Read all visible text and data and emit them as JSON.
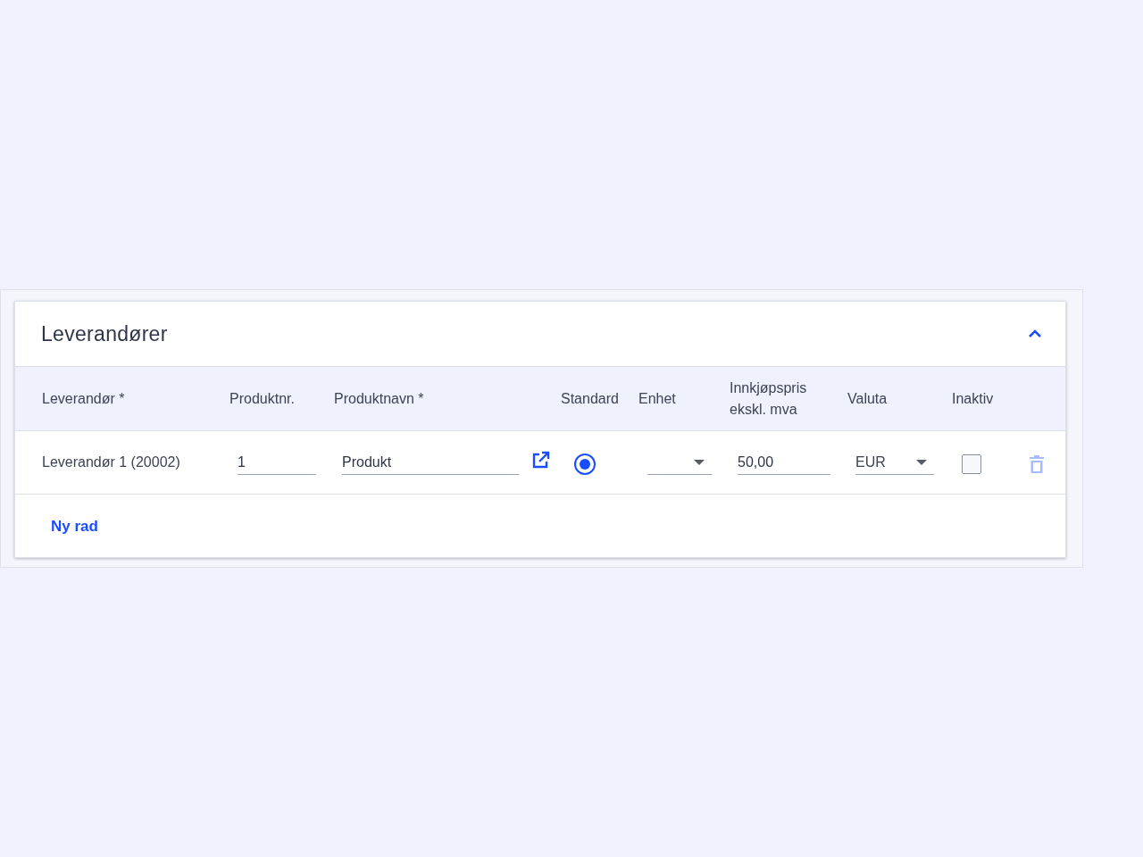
{
  "section": {
    "title": "Leverandører",
    "expanded": true
  },
  "table": {
    "columns": [
      "Leverandør *",
      "Produktnr.",
      "Produktnavn *",
      "Standard",
      "Enhet",
      "Innkjøpspris ekskl. mva",
      "Valuta",
      "Inaktiv"
    ],
    "rows": [
      {
        "supplier": "Leverandør 1 (20002)",
        "product_no": "1",
        "product_name": "Produkt",
        "standard": true,
        "price": "50,00",
        "currency": "EUR",
        "inactive": false
      }
    ]
  },
  "add_row_link": "Ny rad"
}
